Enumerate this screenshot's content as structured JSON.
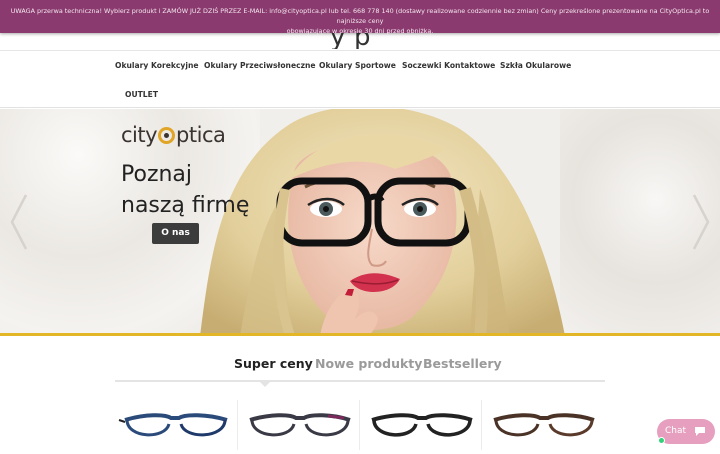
{
  "notice": {
    "line1": "UWAGA przerwa techniczna! Wybierz produkt i ZAMÓW JUŻ DZIŚ PRZEZ E-MAIL: info@cityoptica.pl lub tel. 668 778 140 (dostawy realizowane codziennie bez zmian) Ceny przekreślone prezentowane na CityOptica.pl to najniższe ceny",
    "line2": "obowiązujące w okresie 30 dni przed obniżką."
  },
  "nav": {
    "items": [
      {
        "label": "Okulary Korekcyjne"
      },
      {
        "label": "Okulary Przeciwsłoneczne"
      },
      {
        "label": "Okulary Sportowe"
      },
      {
        "label": "Soczewki Kontaktowe"
      },
      {
        "label": "Szkła Okularowe"
      },
      {
        "label": "OUTLET"
      }
    ]
  },
  "hero": {
    "logo_part1": "city",
    "logo_part2": "ptica",
    "tagline_line1": "Poznaj",
    "tagline_line2": "naszą firmę",
    "button_label": "O nas",
    "accent_color": "#e2b626"
  },
  "tabs": {
    "items": [
      {
        "label": "Super ceny",
        "active": true
      },
      {
        "label": "Nowe produkty",
        "active": false
      },
      {
        "label": "Bestsellery",
        "active": false
      }
    ]
  },
  "products": [
    {
      "frame_color": "#2a4a7a",
      "accent": "#1f3a6a"
    },
    {
      "frame_color": "#3a3a46",
      "accent": "#7a2a5a"
    },
    {
      "frame_color": "#222222",
      "accent": "#222222"
    },
    {
      "frame_color": "#4a3226",
      "accent": "#5a3a2a"
    }
  ],
  "chat": {
    "label": "Chat",
    "color": "#e79fc0"
  },
  "colors": {
    "notice_bg": "#8a3a6e",
    "button_bg": "#3c3c3c"
  }
}
